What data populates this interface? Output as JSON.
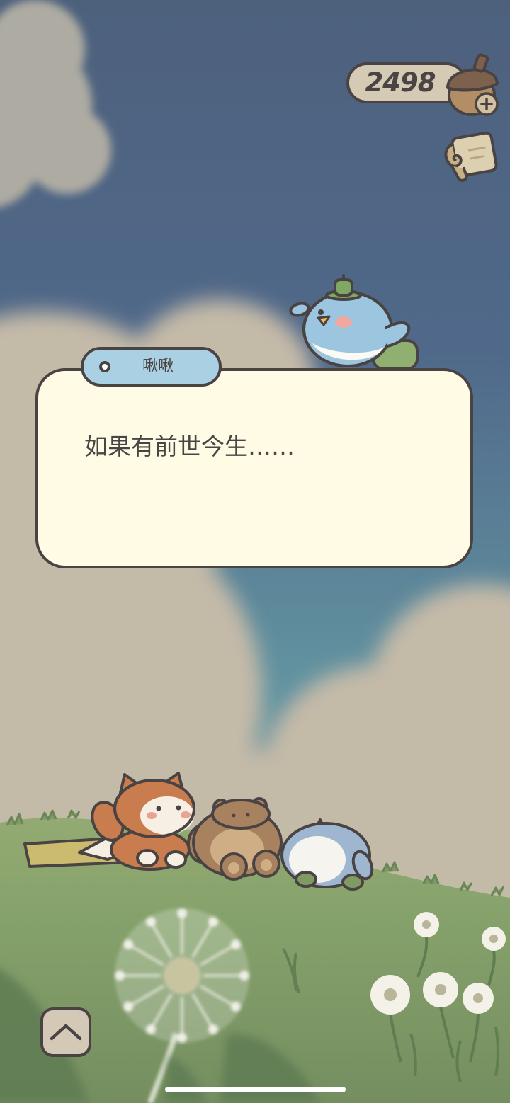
{
  "hud": {
    "currency": {
      "value": "2498",
      "icon": "acorn-icon",
      "add_icon": "plus-icon"
    },
    "menu_icon": "scroll-icon"
  },
  "dialog": {
    "speaker": "啾啾",
    "speaker_icon": "dot-icon",
    "text": "如果有前世今生……"
  },
  "controls": {
    "expand_icon": "chevron-up-icon"
  },
  "colors": {
    "outline": "#4a4343",
    "dialog_bg": "#fffbe5",
    "name_tag_bg": "#a9d0e3",
    "currency_pill_bg": "#d5cab4",
    "button_bg": "#d4c8b7",
    "text": "#4a4444",
    "sky_top": "#4d617d",
    "sky_bottom": "#6293a0",
    "cloud": "#c4baa8",
    "hill": "#84a06a"
  }
}
